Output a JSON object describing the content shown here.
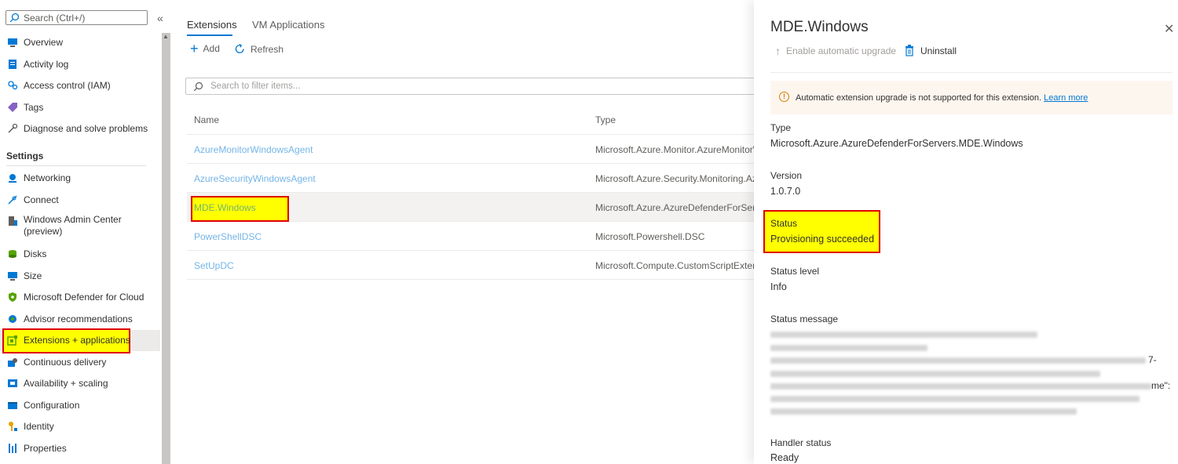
{
  "nav": {
    "search_placeholder": "Search (Ctrl+/)",
    "collapse_glyph": "«",
    "items_top": [
      {
        "label": "Overview",
        "icon": "monitor-icon",
        "color": "#0078d4"
      },
      {
        "label": "Activity log",
        "icon": "log-icon",
        "color": "#0078d4"
      },
      {
        "label": "Access control (IAM)",
        "icon": "people-icon",
        "color": "#0078d4"
      },
      {
        "label": "Tags",
        "icon": "tag-icon",
        "color": "#8661c5"
      },
      {
        "label": "Diagnose and solve problems",
        "icon": "wrench-icon",
        "color": "#605e5c"
      }
    ],
    "settings_heading": "Settings",
    "items_settings": [
      {
        "label": "Networking",
        "icon": "network-icon",
        "color": "#0078d4"
      },
      {
        "label": "Connect",
        "icon": "plug-icon",
        "color": "#0078d4"
      },
      {
        "label": "Windows Admin Center",
        "label2": "(preview)",
        "icon": "server-icon",
        "color": "#605e5c"
      },
      {
        "label": "Disks",
        "icon": "disk-icon",
        "color": "#57a300"
      },
      {
        "label": "Size",
        "icon": "monitor-icon",
        "color": "#0078d4"
      },
      {
        "label": "Microsoft Defender for Cloud",
        "icon": "shield-icon",
        "color": "#57a300"
      },
      {
        "label": "Advisor recommendations",
        "icon": "cloud-icon",
        "color": "#0078d4"
      },
      {
        "label": "Extensions + applications",
        "icon": "extension-icon",
        "color": "#57a300"
      },
      {
        "label": "Continuous delivery",
        "icon": "delivery-icon",
        "color": "#0078d4"
      },
      {
        "label": "Availability + scaling",
        "icon": "scale-icon",
        "color": "#0078d4"
      },
      {
        "label": "Configuration",
        "icon": "config-icon",
        "color": "#0078d4"
      },
      {
        "label": "Identity",
        "icon": "identity-icon",
        "color": "#e8a200"
      },
      {
        "label": "Properties",
        "icon": "properties-icon",
        "color": "#0078d4"
      }
    ]
  },
  "main": {
    "tabs": [
      "Extensions",
      "VM Applications"
    ],
    "add_label": "Add",
    "refresh_label": "Refresh",
    "filter_placeholder": "Search to filter items...",
    "columns": [
      "Name",
      "Type"
    ],
    "rows": [
      {
        "name": "AzureMonitorWindowsAgent",
        "type": "Microsoft.Azure.Monitor.AzureMonitorWindowsAgent"
      },
      {
        "name": "AzureSecurityWindowsAgent",
        "type": "Microsoft.Azure.Security.Monitoring.AzureSecurityWindowsAgent"
      },
      {
        "name": "MDE.Windows",
        "type": "Microsoft.Azure.AzureDefenderForServers.MDE.Windows"
      },
      {
        "name": "PowerShellDSC",
        "type": "Microsoft.Powershell.DSC"
      },
      {
        "name": "SetUpDC",
        "type": "Microsoft.Compute.CustomScriptExtension"
      }
    ]
  },
  "panel": {
    "title": "MDE.Windows",
    "enable_upgrade_label": "Enable automatic upgrade",
    "uninstall_label": "Uninstall",
    "banner_text": "Automatic extension upgrade is not supported for this extension.",
    "banner_link": "Learn more",
    "type_label": "Type",
    "type_value": "Microsoft.Azure.AzureDefenderForServers.MDE.Windows",
    "version_label": "Version",
    "version_value": "1.0.7.0",
    "status_label": "Status",
    "status_value": "Provisioning succeeded",
    "status_level_label": "Status level",
    "status_level_value": "Info",
    "status_message_label": "Status message",
    "status_message_fragments": [
      "7-",
      "me\":"
    ],
    "handler_status_label": "Handler status",
    "handler_status_value": "Ready"
  },
  "colors": {
    "accent": "#0078d4",
    "highlight": "#ffff00",
    "highlight_border": "#e00000"
  }
}
